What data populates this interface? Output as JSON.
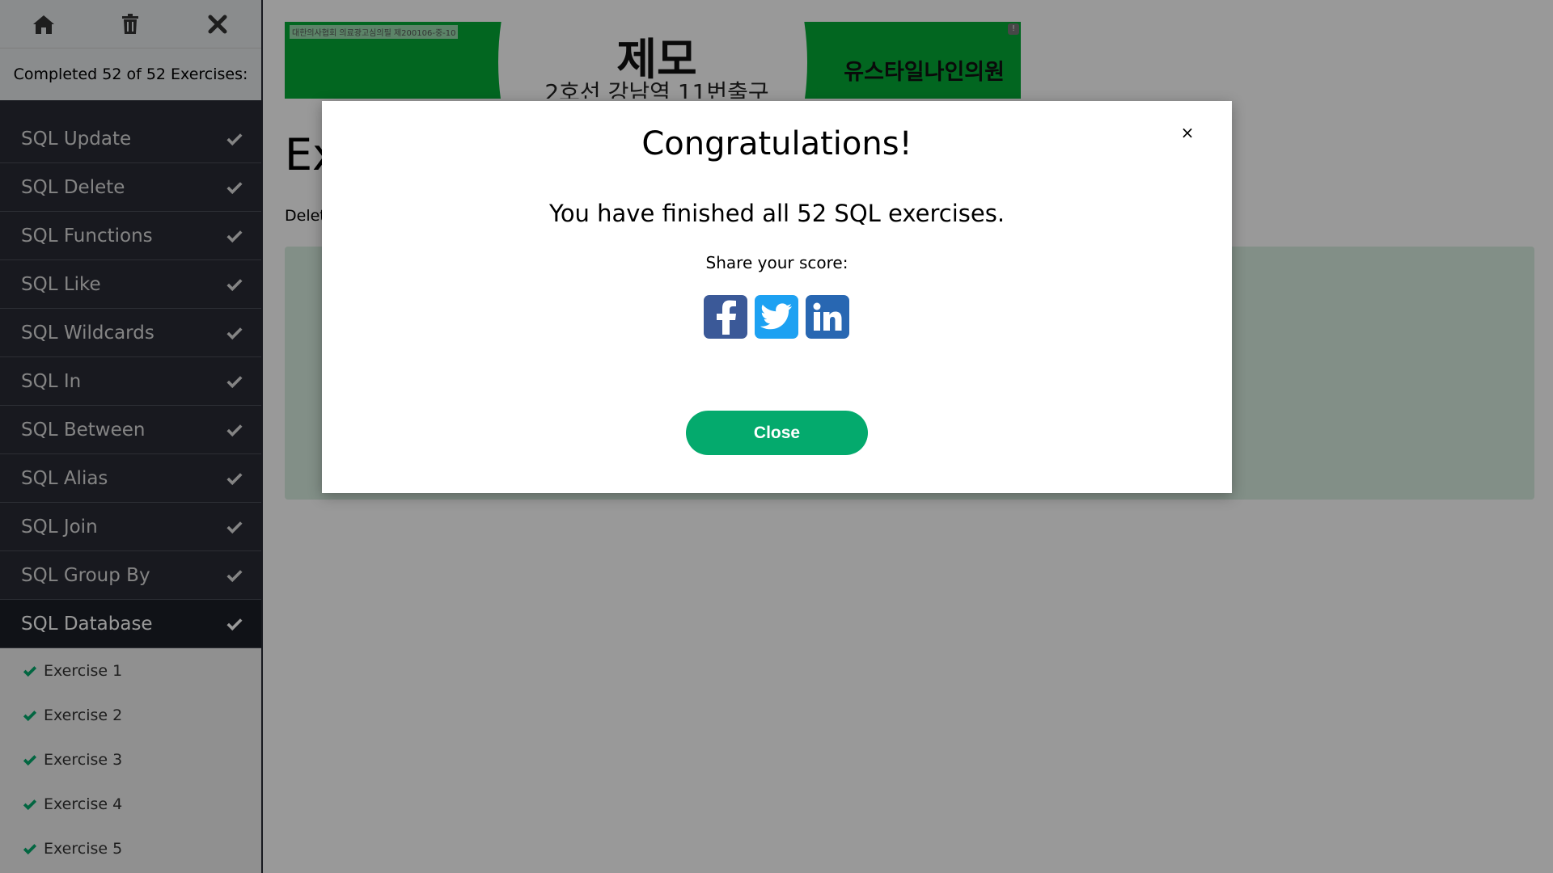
{
  "sidebar": {
    "progress_text": "Completed 52 of 52 Exercises:",
    "sections": [
      {
        "label": "SQL Update"
      },
      {
        "label": "SQL Delete"
      },
      {
        "label": "SQL Functions"
      },
      {
        "label": "SQL Like"
      },
      {
        "label": "SQL Wildcards"
      },
      {
        "label": "SQL In"
      },
      {
        "label": "SQL Between"
      },
      {
        "label": "SQL Alias"
      },
      {
        "label": "SQL Join"
      },
      {
        "label": "SQL Group By"
      },
      {
        "label": "SQL Database"
      }
    ],
    "exercises": [
      {
        "label": "Exercise 1"
      },
      {
        "label": "Exercise 2"
      },
      {
        "label": "Exercise 3"
      },
      {
        "label": "Exercise 4"
      },
      {
        "label": "Exercise 5"
      }
    ]
  },
  "ad": {
    "small_text": "대한의사협회 의료광고심의필 제200106-중-10",
    "title": "제모",
    "subtitle": "2호선 강남역 11번출구",
    "right_text": "유스타일나인의원"
  },
  "main": {
    "heading": "Ex",
    "desc": "Delet"
  },
  "modal": {
    "close_x": "×",
    "title": "Congratulations!",
    "message": "You have finished all 52 SQL exercises.",
    "share_label": "Share your score:",
    "close_button": "Close"
  },
  "colors": {
    "sidebar_dark": "#282a35",
    "check_green": "#04aa6d",
    "close_button": "#04aa6d",
    "facebook": "#3b5998",
    "twitter": "#1da1f2",
    "linkedin": "#2867b2"
  },
  "icons": {
    "top": [
      "home-icon",
      "trash-icon",
      "close-icon"
    ],
    "section_check": "check-icon",
    "share": [
      "facebook-icon",
      "twitter-icon",
      "linkedin-icon"
    ]
  }
}
